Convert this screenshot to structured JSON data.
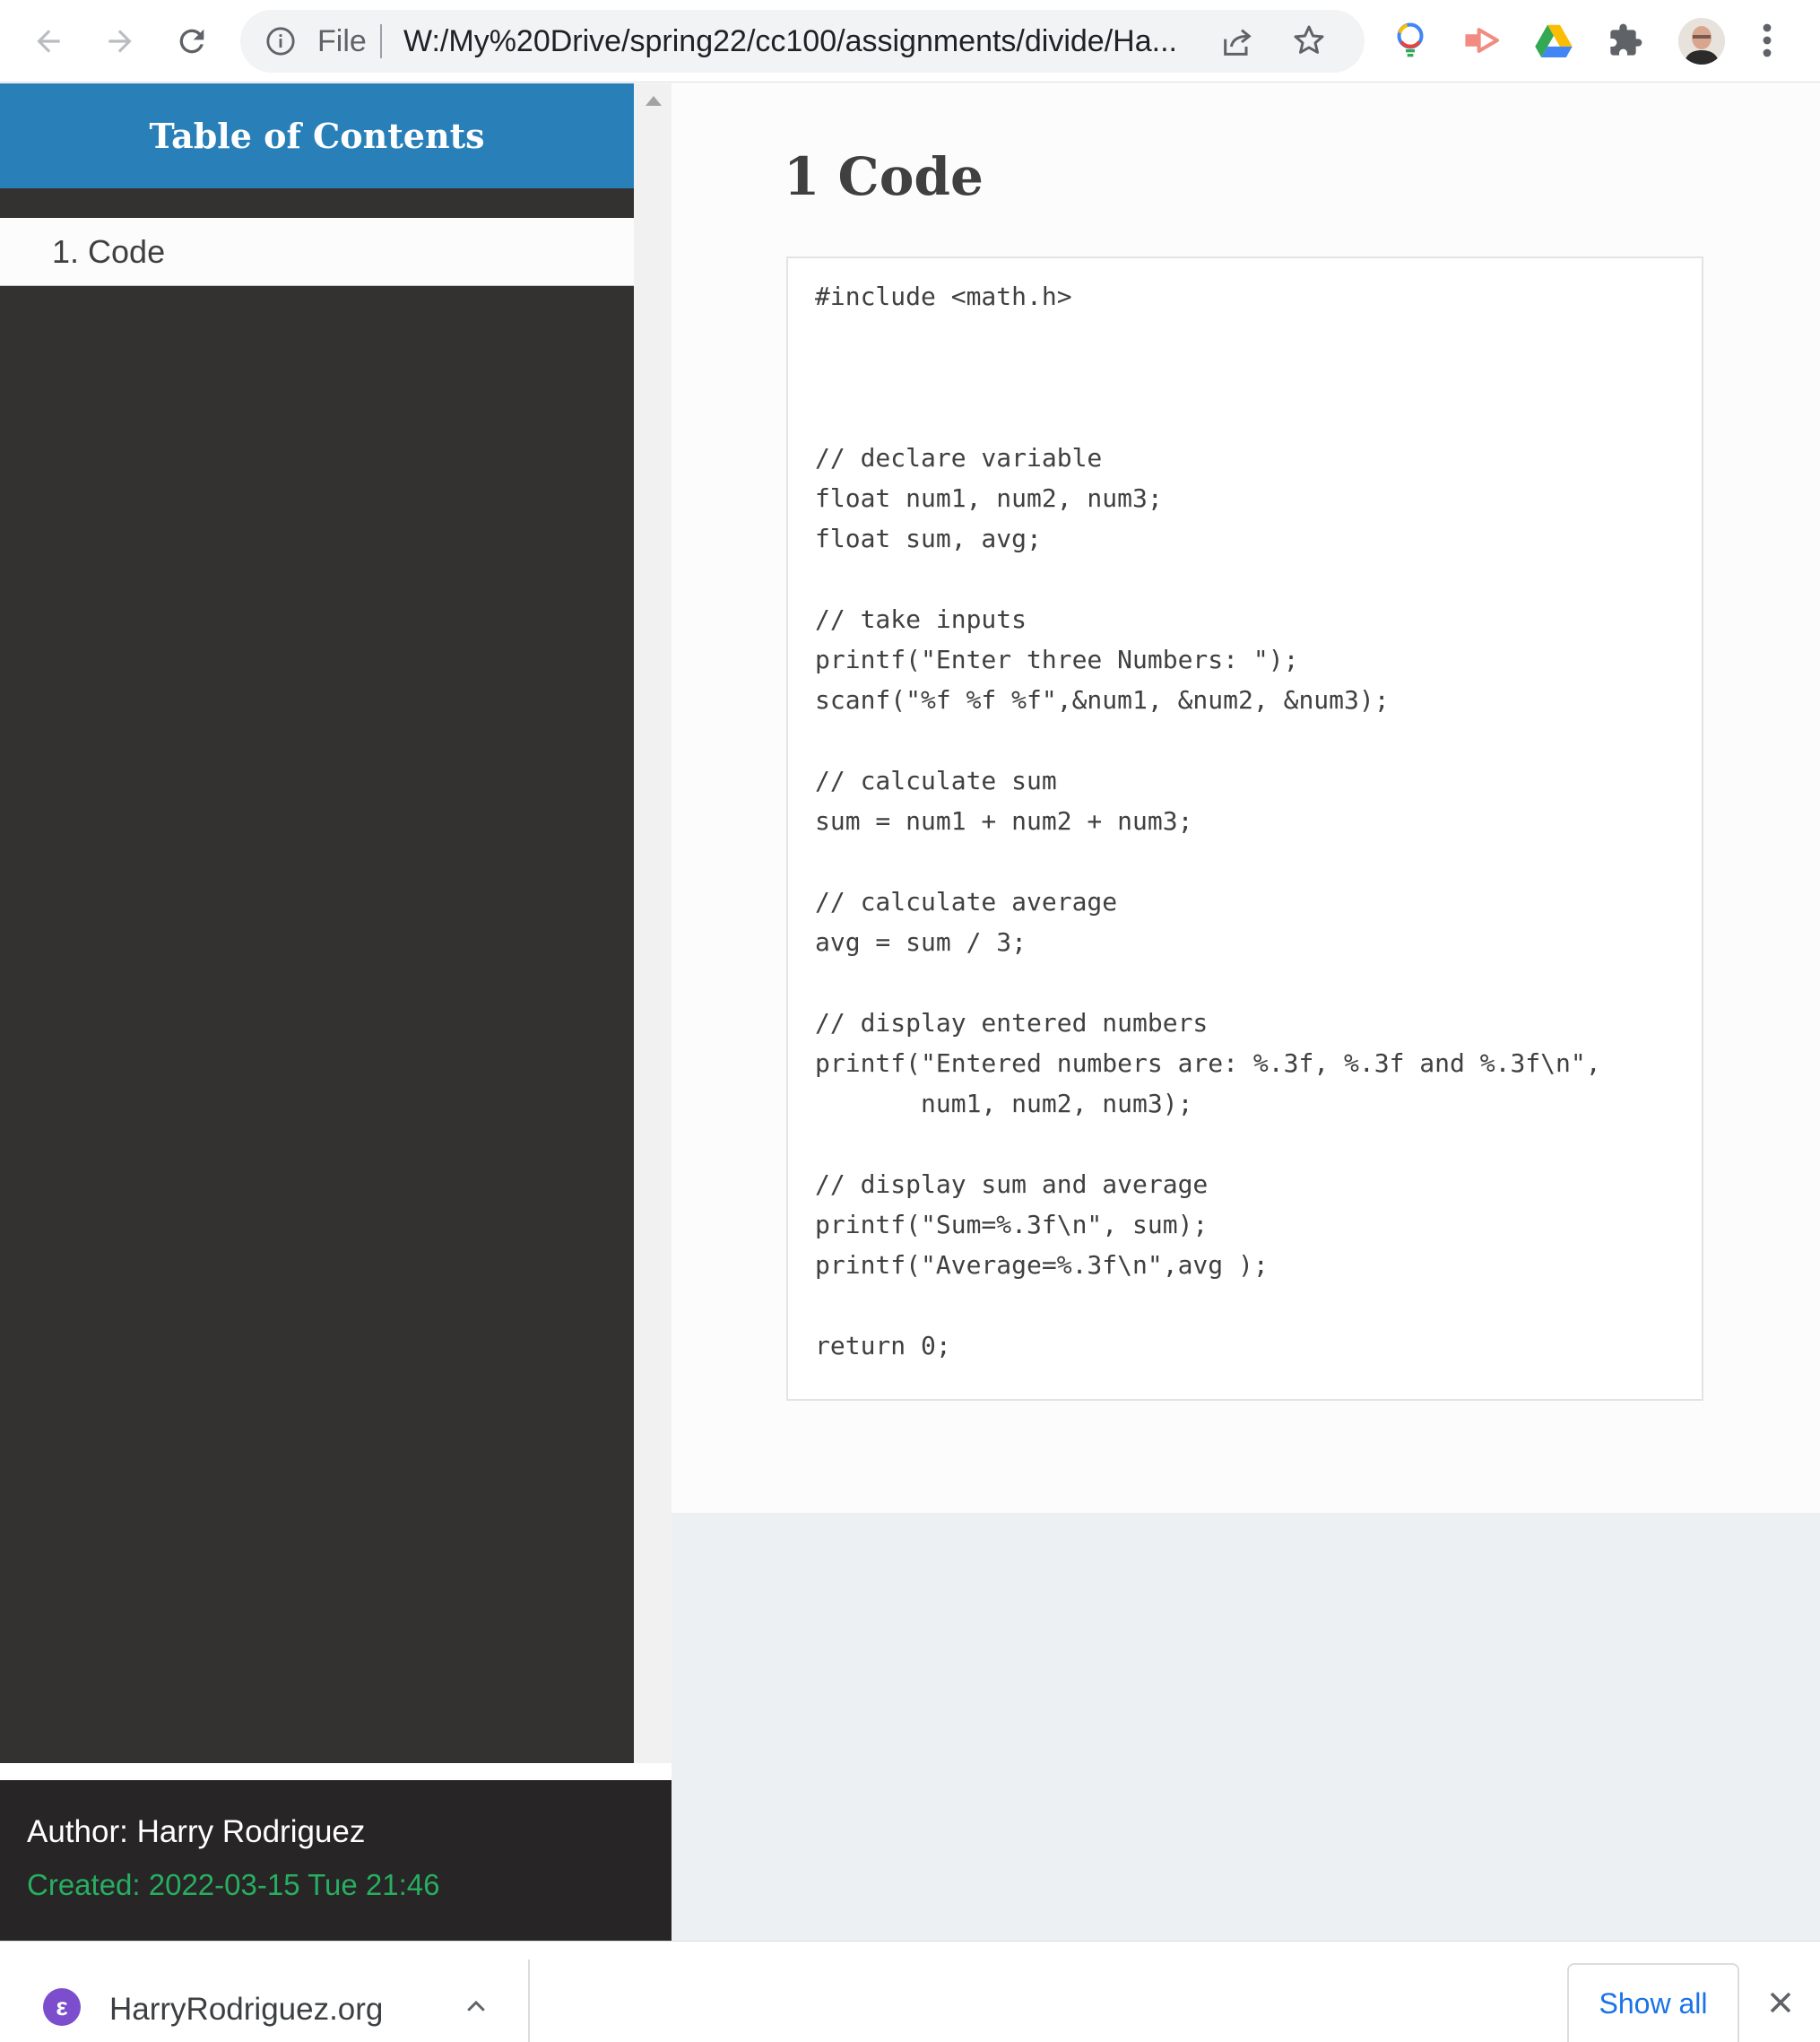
{
  "browser": {
    "omnibox_scheme": "File",
    "url": "W:/My%20Drive/spring22/cc100/assignments/divide/Ha..."
  },
  "sidebar": {
    "title": "Table of Contents",
    "items": [
      {
        "label": "1. Code"
      }
    ]
  },
  "footer": {
    "author": "Author: Harry Rodriguez",
    "created": "Created: 2022-03-15 Tue 21:46"
  },
  "content": {
    "heading": "1 Code",
    "code": "#include <math.h>\n\n\n\n// declare variable\nfloat num1, num2, num3;\nfloat sum, avg;\n\n// take inputs\nprintf(\"Enter three Numbers: \");\nscanf(\"%f %f %f\",&num1, &num2, &num3);\n\n// calculate sum\nsum = num1 + num2 + num3;\n\n// calculate average\navg = sum / 3;\n\n// display entered numbers\nprintf(\"Entered numbers are: %.3f, %.3f and %.3f\\n\",\n       num1, num2, num3);\n\n// display sum and average\nprintf(\"Sum=%.3f\\n\", sum);\nprintf(\"Average=%.3f\\n\",avg );\n\nreturn 0;"
  },
  "download_bar": {
    "file_name": "HarryRodriguez.org",
    "show_all": "Show all"
  },
  "colors": {
    "toc_header": "#2980b9",
    "sidebar_bg": "#343131",
    "created_text": "#27ae60",
    "link_blue": "#1a73e8"
  },
  "icons": [
    "back-arrow-icon",
    "forward-arrow-icon",
    "reload-icon",
    "info-icon",
    "share-icon",
    "star-icon",
    "lightbulb-extension-icon",
    "video-extension-icon",
    "google-drive-icon",
    "puzzle-extensions-icon",
    "profile-avatar",
    "more-menu-icon",
    "emacs-file-icon",
    "chevron-up-icon",
    "close-icon"
  ]
}
